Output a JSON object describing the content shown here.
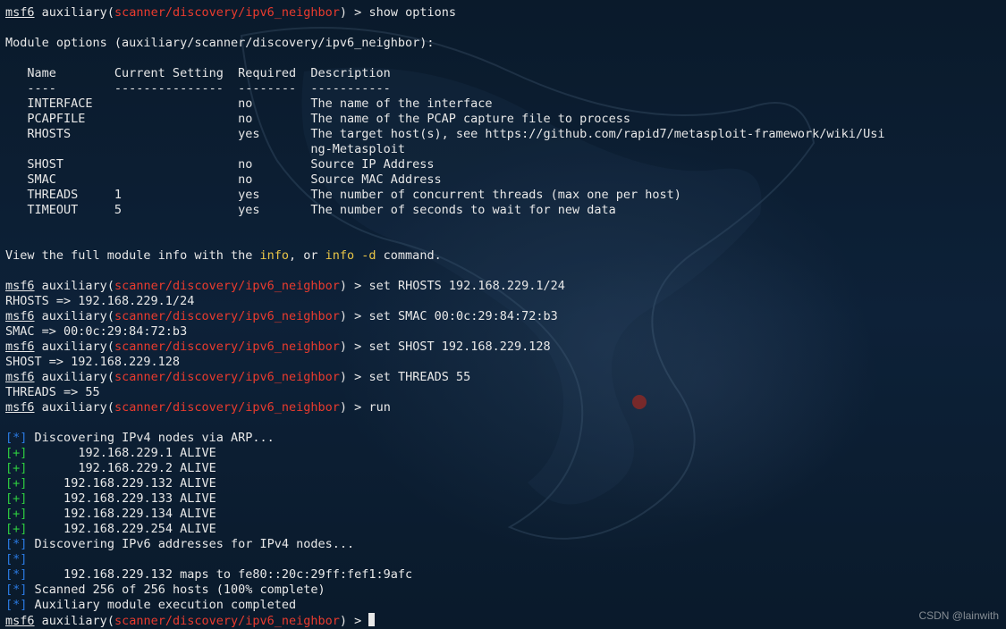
{
  "prompt": {
    "prefix": "msf6",
    "auxword": "auxiliary",
    "open": "(",
    "module": "scanner/discovery/ipv6_neighbor",
    "close": ") > "
  },
  "cmd": {
    "show_options": "show options",
    "set_rhosts": "set RHOSTS 192.168.229.1/24",
    "set_smac": "set SMAC 00:0c:29:84:72:b3",
    "set_shost": "set SHOST 192.168.229.128",
    "set_threads": "set THREADS 55",
    "run": "run"
  },
  "header": {
    "module_options": "Module options (auxiliary/scanner/discovery/ipv6_neighbor):",
    "col_name": "Name",
    "col_setting": "Current Setting",
    "col_required": "Required",
    "col_desc": "Description",
    "dash_name": "----",
    "dash_setting": "---------------",
    "dash_required": "--------",
    "dash_desc": "-----------"
  },
  "options": [
    {
      "name": "INTERFACE",
      "setting": "",
      "required": "no",
      "desc": "The name of the interface"
    },
    {
      "name": "PCAPFILE",
      "setting": "",
      "required": "no",
      "desc": "The name of the PCAP capture file to process"
    },
    {
      "name": "RHOSTS",
      "setting": "",
      "required": "yes",
      "desc": "The target host(s), see https://github.com/rapid7/metasploit-framework/wiki/Usi"
    },
    {
      "name": "",
      "setting": "",
      "required": "",
      "desc": "ng-Metasploit"
    },
    {
      "name": "SHOST",
      "setting": "",
      "required": "no",
      "desc": "Source IP Address"
    },
    {
      "name": "SMAC",
      "setting": "",
      "required": "no",
      "desc": "Source MAC Address"
    },
    {
      "name": "THREADS",
      "setting": "1",
      "required": "yes",
      "desc": "The number of concurrent threads (max one per host)"
    },
    {
      "name": "TIMEOUT",
      "setting": "5",
      "required": "yes",
      "desc": "The number of seconds to wait for new data"
    }
  ],
  "footer": {
    "pre": "View the full module info with the ",
    "info": "info",
    "mid": ", or ",
    "info_d": "info -d",
    "post": " command."
  },
  "echo": {
    "rhosts": "RHOSTS => 192.168.229.1/24",
    "smac": "SMAC => 00:0c:29:84:72:b3",
    "shost": "SHOST => 192.168.229.128",
    "threads": "THREADS => 55"
  },
  "status": {
    "star_open": "[",
    "star": "*",
    "plus": "+",
    "star_close": "]",
    "discover_ipv4": " Discovering IPv4 nodes via ARP...",
    "alive1": "       192.168.229.1 ALIVE",
    "alive2": "       192.168.229.2 ALIVE",
    "alive132": "     192.168.229.132 ALIVE",
    "alive133": "     192.168.229.133 ALIVE",
    "alive134": "     192.168.229.134 ALIVE",
    "alive254": "     192.168.229.254 ALIVE",
    "discover_ipv6": " Discovering IPv6 addresses for IPv4 nodes...",
    "blank": "",
    "maps": "     192.168.229.132 maps to fe80::20c:29ff:fef1:9afc",
    "scanned": " Scanned 256 of 256 hosts (100% complete)",
    "completed": " Auxiliary module execution completed"
  },
  "watermark": "CSDN @lainwith"
}
